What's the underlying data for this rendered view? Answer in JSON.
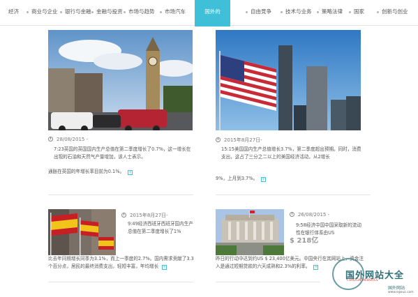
{
  "nav": {
    "items": [
      {
        "label": "经济"
      },
      {
        "label": "商业与企业"
      },
      {
        "label": "银行与金融"
      },
      {
        "label": "金融与投资"
      },
      {
        "label": "市场与趋势"
      },
      {
        "label": "市场汽车"
      },
      {
        "label": "国外的"
      },
      {
        "label": "自由竞争"
      },
      {
        "label": "技术与业务"
      },
      {
        "label": "策略法律"
      },
      {
        "label": "国家"
      },
      {
        "label": "创新与创业"
      }
    ],
    "active_index": 6,
    "accent_color": "#3fc0d8"
  },
  "articles": [
    {
      "date": "28/08/2015 -",
      "lead": "7:23英国的英国国内生产总值在第二季度增长了0.7%，这一增长在出现的石油和天然气产量增加，该人士表示。",
      "summary": "通胀在英国的年增长率目前为0.1%。",
      "more_icon": "plus-box-icon"
    },
    {
      "date": "2015年8月27日-",
      "lead": "15:15美国国内生产总值增长3.7%，第二季度超出预期。同时，消费支出，这占了三分之二以上的美国经济活动，从2增长",
      "summary": "9%，上月到3.7%。",
      "more_icon": "plus-box-icon"
    },
    {
      "date": "2015年8月27日-",
      "lead": "9:49经济西班牙西班牙国内生产总值在第二季度增长了1%",
      "summary": "比去年同期增长同季为3.1%，而上一季度的2.7%。国内需求贡献了3.3个百分点，居民的最终消费支出，轻短丰富，年均增长",
      "more_icon": "plus-box-icon"
    },
    {
      "date": "26/08/2015 -",
      "lead": "9:58经济中国中国采取新的流动性在银行体系由US",
      "photo_caption": "$ 218亿",
      "summary": "昨日的行动中达到约US $ 23,400亿美元。中国央行在其网站上，资金注入是通过短期贷款的六天成熟和2.3%的利率。",
      "more_icon": "plus-box-icon"
    }
  ],
  "watermark": {
    "title": "国外网站大全",
    "subtitle": "FOREIGN WEBSITES",
    "site": "国外网站",
    "url": "www.egouz.com"
  }
}
